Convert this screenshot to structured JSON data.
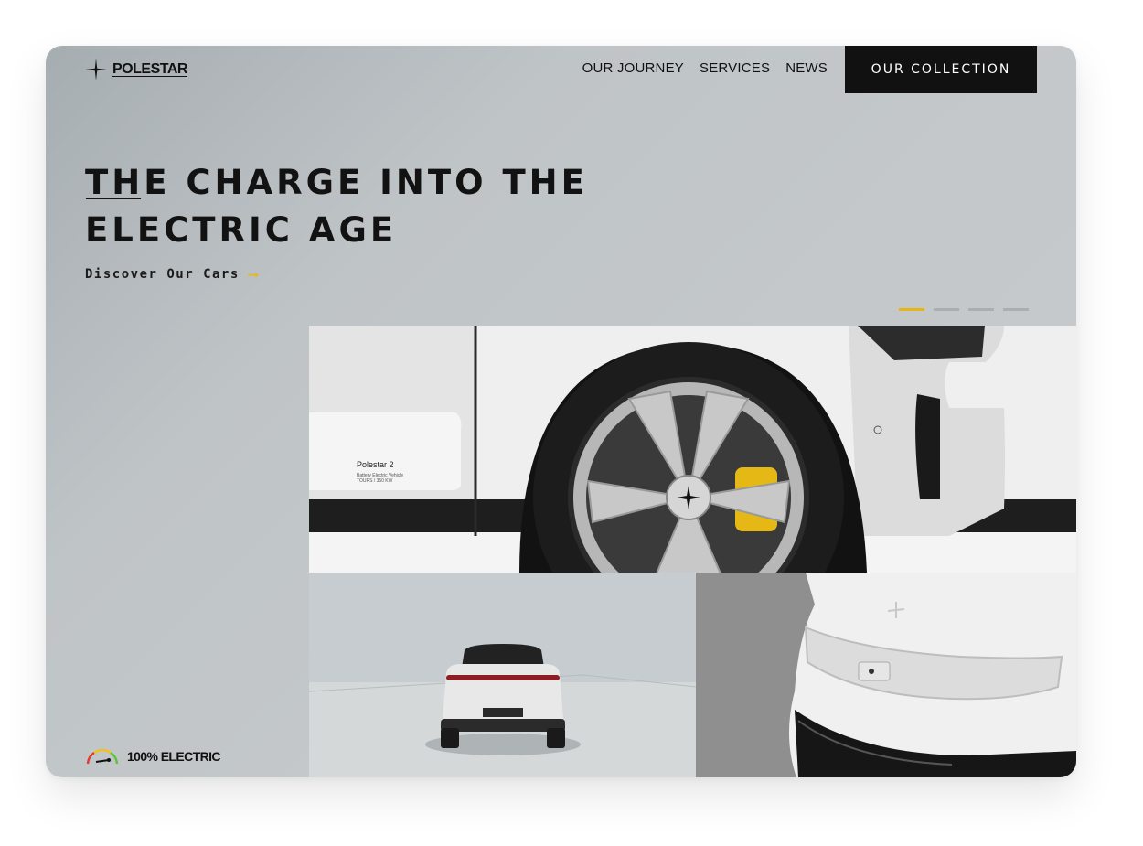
{
  "brand": {
    "name": "POLESTAR",
    "logo_icon": "polestar-star-icon"
  },
  "nav": {
    "items": [
      "OUR JOURNEY",
      "SERVICES",
      "NEWS"
    ]
  },
  "cta": {
    "label": "OUR COLLECTION"
  },
  "hero": {
    "headline_line1": "THE CHARGE INTO THE",
    "headline_line2": "ELECTRIC AGE",
    "discover_label": "Discover Our Cars",
    "arrow_icon": "arrow-right-icon"
  },
  "carousel": {
    "total": 4,
    "active": 1
  },
  "images": {
    "side_label": "Polestar 2",
    "side_sub1": "Battery Electric Vehicle",
    "side_sub2": "TOURS / 350 KW"
  },
  "badge": {
    "label": "100% ELECTRIC",
    "icon": "gauge-icon"
  },
  "colors": {
    "accent": "#e5b616",
    "dark": "#111111",
    "background": "#c4c8ca"
  }
}
